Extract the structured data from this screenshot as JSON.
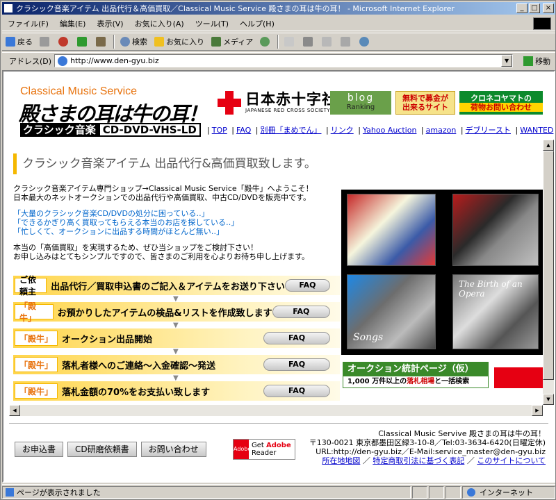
{
  "window": {
    "title": "クラシック音楽アイテム 出品代行＆高価買取／Classical Music Service 殿さまの耳は牛の耳！ - Microsoft Internet Explorer",
    "minimize": "_",
    "maximize": "□",
    "close": "×"
  },
  "menubar": [
    "ファイル(F)",
    "編集(E)",
    "表示(V)",
    "お気に入り(A)",
    "ツール(T)",
    "ヘルプ(H)"
  ],
  "toolbar": {
    "back": "戻る",
    "search": "検索",
    "favorites": "お気に入り",
    "media": "メディア"
  },
  "address": {
    "label": "アドレス(D)",
    "url": "http://www.den-gyu.biz",
    "go": "移動"
  },
  "header": {
    "logo_en": "Classical Music Service",
    "logo_jp": "殿さまの耳は牛の耳！",
    "logo_sub_black": "クラシック音楽",
    "logo_sub_white": "CD-DVD-VHS-LD",
    "redcross_jp": "日本赤十字社",
    "redcross_en": "JAPANESE RED CROSS SOCIETY",
    "blog_1": "blog",
    "blog_2": "Ranking",
    "boki_1": "無料で募金が",
    "boki_2": "出来るサイト",
    "kuro_1": "クロネコヤマトの",
    "kuro_2": "荷物お問い合わせ"
  },
  "nav": [
    "TOP",
    "FAQ",
    "別冊「まめでん」",
    "リンク",
    "Yahoo Auction",
    "amazon",
    "デブリースト",
    "WANTED"
  ],
  "main": {
    "heading": "クラシック音楽アイテム 出品代行&高価買取致します。",
    "intro_1": "クラシック音楽アイテム専門ショップ→Classical Music Service「殿牛」へようこそ！",
    "intro_2": "日本最大のネットオークションでの出品代行や高価買取、中古CD/DVDを販売中です。",
    "quote_1": "「大量のクラシック音楽CD/DVDの処分に困っている‥」",
    "quote_2": "「できるかぎり高く買取ってもらえる本当のお店を探している‥」",
    "quote_3": "「忙しくて、オークションに出品する時間がほとんど無い‥」",
    "closing_1": "本当の「高価買取」を実現するため、ぜひ当ショップをご検討下さい！",
    "closing_2": "お申し込みはとてもシンプルですので、皆さまのご利用を心よりお待ち申し上げます。"
  },
  "steps": [
    {
      "badge": "ご依頼主",
      "text": "出品代行／買取申込書のご記入＆アイテムをお送り下さい",
      "faq": "FAQ"
    },
    {
      "badge": "「殿牛」",
      "text": "お預かりしたアイテムの検品&リストを作成致します",
      "faq": "FAQ"
    },
    {
      "badge": "「殿牛」",
      "text": "オークション出品開始",
      "faq": "FAQ"
    },
    {
      "badge": "「殿牛」",
      "text": "落札者様へのご連絡～入金確認～発送",
      "faq": "FAQ"
    },
    {
      "badge": "「殿牛」",
      "text": "落札金額の70%をお支払い致します",
      "faq": "FAQ"
    }
  ],
  "step_arrow": "▼",
  "cds": {
    "songs": "Songs",
    "opera": "The Birth of an Opera"
  },
  "auction_banner": {
    "title": "オークション統計ページ（仮）",
    "sub_a": "1,000 万件以上の",
    "sub_b": "落札相場",
    "sub_c": "と一括検索"
  },
  "footer": {
    "btn_apply": "お申込書",
    "btn_cd": "CD研磨依頼書",
    "btn_contact": "お問い合わせ",
    "adobe_get": "Get",
    "adobe_name": "Adobe",
    "adobe_reader": "Reader",
    "adobe_logo": "Adobe",
    "line1": "Classical Music Servive 殿さまの耳は牛の耳！",
    "line2": "〒130-0021 東京都墨田区緑3-10-8／Tel:03-3634-6420(日曜定休)",
    "line3": "URL:http://den-gyu.biz／E-Mail:service_master@den-gyu.biz",
    "link_map": "所在地地図",
    "link_law": "特定商取引法に基づく表記",
    "link_about": "このサイトについて"
  },
  "status": {
    "text": "ページが表示されました",
    "zone": "インターネット"
  }
}
